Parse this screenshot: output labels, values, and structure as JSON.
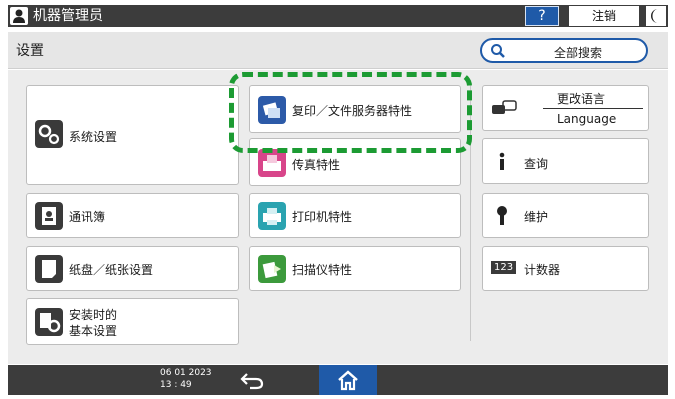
{
  "topbar": {
    "title": "机器管理员",
    "help_label": "?",
    "logout_label": "注销"
  },
  "header": {
    "title": "设置",
    "search_label": "全部搜索"
  },
  "tiles": {
    "system": "系统设置",
    "copy_doc": "复印／文件服务器特性",
    "fax": "传真特性",
    "address_book": "通讯簿",
    "printer": "打印机特性",
    "tray_paper": "纸盘／纸张设置",
    "scanner": "扫描仪特性",
    "install_line1": "安装时的",
    "install_line2": "基本设置",
    "language_cn": "更改语言",
    "language_en": "Language",
    "inquiry": "查询",
    "maintenance": "维护",
    "counter": "计数器",
    "counter_badge": "123"
  },
  "footer": {
    "date": "06 01 2023",
    "time": "13 : 49"
  },
  "colors": {
    "highlight": "#1c9b33",
    "accent": "#1f5aa8",
    "bar": "#3c3c3c"
  }
}
